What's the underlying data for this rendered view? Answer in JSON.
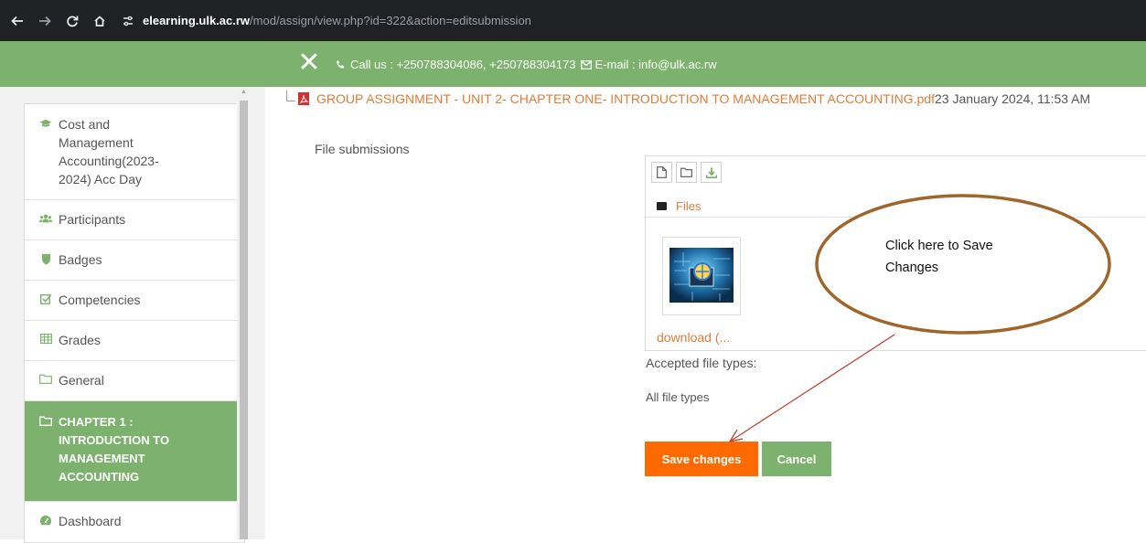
{
  "browser": {
    "url_host": "elearning.ulk.ac.rw",
    "url_path": "/mod/assign/view.php?id=322&action=editsubmission"
  },
  "header": {
    "call_text": "Call us : +250788304086, +250788304173",
    "email_text": "E-mail : info@ulk.ac.rw",
    "brand_color": "#7cb26d"
  },
  "sidebar": {
    "items": [
      {
        "label": "Cost and Management Accounting(2023-2024) Acc Day",
        "icon": "graduation-cap-icon"
      },
      {
        "label": "Participants",
        "icon": "users-icon"
      },
      {
        "label": "Badges",
        "icon": "shield-icon"
      },
      {
        "label": "Competencies",
        "icon": "checkbox-icon"
      },
      {
        "label": "Grades",
        "icon": "table-icon"
      },
      {
        "label": "General",
        "icon": "folder-icon"
      },
      {
        "label": "CHAPTER 1 : INTRODUCTION TO MANAGEMENT ACCOUNTING",
        "icon": "folder-icon",
        "active": true
      },
      {
        "label": "Dashboard",
        "icon": "dashboard-icon"
      }
    ]
  },
  "main": {
    "file_name": "GROUP ASSIGNMENT - UNIT 2- CHAPTER ONE- INTRODUCTION TO MANAGEMENT ACCOUNTING.pdf",
    "file_date": "23 January 2024, 11:53 AM",
    "submissions_label": "File submissions",
    "files_folder": "Files",
    "thumb_filename": "download (...",
    "accepted_label": "Accepted file types:",
    "all_types": "All file types",
    "save_label": "Save changes",
    "cancel_label": "Cancel",
    "accent_color": "#ff6a00",
    "link_color": "#e07b39"
  },
  "annotation": {
    "text": "Click here to Save Changes",
    "stroke_color": "#a0652a",
    "arrow_color": "#c0392b"
  }
}
